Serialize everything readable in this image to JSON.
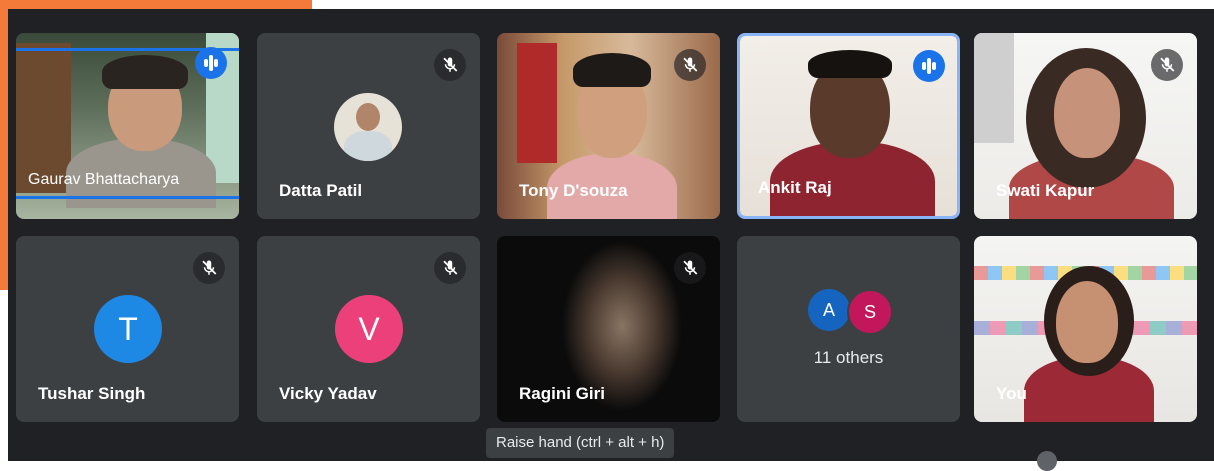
{
  "participants": [
    {
      "name": "Gaurav Bhattacharya",
      "state": "speaking"
    },
    {
      "name": "Datta Patil",
      "state": "muted"
    },
    {
      "name": "Tony D'souza",
      "state": "muted"
    },
    {
      "name": "Ankit Raj",
      "state": "speaking"
    },
    {
      "name": "Swati Kapur",
      "state": "muted"
    },
    {
      "name": "Tushar Singh",
      "state": "muted",
      "initial": "T",
      "avatar_color": "#1e88e5"
    },
    {
      "name": "Vicky Yadav",
      "state": "muted",
      "initial": "V",
      "avatar_color": "#ec407a"
    },
    {
      "name": "Ragini Giri",
      "state": "muted"
    },
    {
      "name": "You",
      "state": "video"
    }
  ],
  "others": {
    "count_label": "11 others",
    "avatars": [
      {
        "initial": "A",
        "color": "#1565c0"
      },
      {
        "initial": "S",
        "color": "#c2185b"
      }
    ]
  },
  "tooltip": "Raise hand (ctrl + alt + h)",
  "icons": {
    "mic_off": "mic-off-icon",
    "audio_level": "audio-level-icon"
  },
  "colors": {
    "background": "#202124",
    "tile": "#3c4043",
    "speaking_border": "#8ab4f8",
    "accent": "#1a73e8",
    "banner": "#f47a3a"
  }
}
